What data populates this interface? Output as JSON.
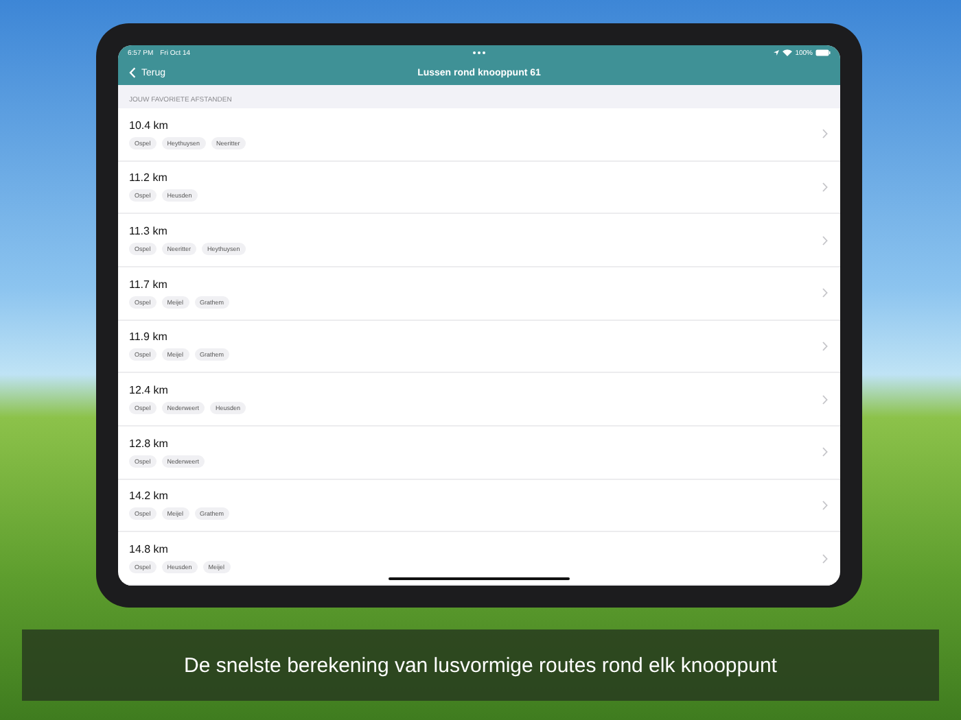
{
  "status_bar": {
    "time": "6:57 PM",
    "date": "Fri Oct 14",
    "battery": "100%"
  },
  "nav_bar": {
    "back": "Terug",
    "title": "Lussen rond knooppunt 61"
  },
  "section": {
    "header": "JOUW FAVORIETE AFSTANDEN"
  },
  "routes": [
    {
      "distance": "10.4 km",
      "places": [
        "Ospel",
        "Heythuysen",
        "Neeritter"
      ]
    },
    {
      "distance": "11.2 km",
      "places": [
        "Ospel",
        "Heusden"
      ]
    },
    {
      "distance": "11.3 km",
      "places": [
        "Ospel",
        "Neeritter",
        "Heythuysen"
      ]
    },
    {
      "distance": "11.7 km",
      "places": [
        "Ospel",
        "Meijel",
        "Grathem"
      ]
    },
    {
      "distance": "11.9 km",
      "places": [
        "Ospel",
        "Meijel",
        "Grathem"
      ]
    },
    {
      "distance": "12.4 km",
      "places": [
        "Ospel",
        "Nederweert",
        "Heusden"
      ]
    },
    {
      "distance": "12.8 km",
      "places": [
        "Ospel",
        "Nederweert"
      ]
    },
    {
      "distance": "14.2 km",
      "places": [
        "Ospel",
        "Meijel",
        "Grathem"
      ]
    },
    {
      "distance": "14.8 km",
      "places": [
        "Ospel",
        "Heusden",
        "Meijel"
      ]
    }
  ],
  "caption": "De snelste berekening van lusvormige routes rond elk knooppunt"
}
